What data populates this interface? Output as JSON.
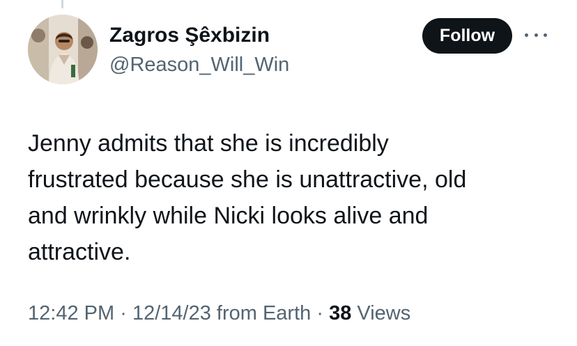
{
  "author": {
    "name": "Zagros Şêxbizin",
    "handle": "@Reason_Will_Win"
  },
  "actions": {
    "follow_label": "Follow",
    "more_icon": "more-horizontal-icon"
  },
  "tweet": {
    "lines": [
      "Jenny admits that she is incredibly",
      "frustrated because she is unattractive, old",
      "and wrinkly while Nicki looks alive and",
      "attractive."
    ]
  },
  "meta": {
    "time": "12:42 PM",
    "separator": "·",
    "date": "12/14/23",
    "source": "from Earth",
    "views_count": "38",
    "views_label": "Views"
  },
  "colors": {
    "text_primary": "#0f1419",
    "text_secondary": "#536471",
    "button_bg": "#0f1419",
    "button_text": "#ffffff"
  }
}
